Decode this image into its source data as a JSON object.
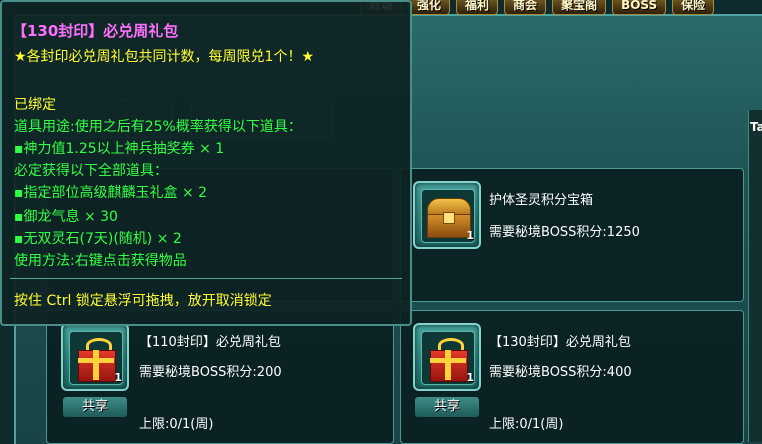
{
  "top_nav": {
    "tabs": [
      "商城",
      "强化",
      "福利",
      "商会",
      "聚宝阁",
      "BOSS",
      "保险"
    ]
  },
  "side_strip": {
    "glyph": "Ta"
  },
  "items": [
    {
      "icon": "treasure-chest",
      "count": "1",
      "name": "护体圣灵积分宝箱",
      "cost": "需要秘境BOSS积分:1250"
    },
    {
      "icon": "gift-box",
      "count": "1",
      "name": "【110封印】必兑周礼包",
      "cost": "需要秘境BOSS积分:200",
      "limit": "上限:0/1(周)",
      "share_label": "共享"
    },
    {
      "icon": "gift-box",
      "count": "1",
      "name": "【130封印】必兑周礼包",
      "cost": "需要秘境BOSS积分:400",
      "limit": "上限:0/1(周)",
      "share_label": "共享"
    }
  ],
  "tooltip": {
    "title": "【130封印】必兑周礼包",
    "notice": "★各封印必兑周礼包共同计数，每周限兑1个！★",
    "bound": "已绑定",
    "usage": "道具用途:使用之后有25%概率获得以下道具：",
    "chance_item": "▪神力值1.25以上神兵抽奖券  × 1",
    "guaranteed": "必定获得以下全部道具：",
    "guaranteed_items": [
      "▪指定部位高级麒麟玉礼盒  × 2",
      "▪御龙气息  × 30",
      "▪无双灵石(7天)(随机)  × 2"
    ],
    "method": "使用方法:右键点击获得物品",
    "lock_hint": "按住 Ctrl 锁定悬浮可拖拽，放开取消锁定"
  },
  "colors": {
    "title": "#ff70ff",
    "yellow_text": "#ffff33",
    "green_text": "#33ff44"
  }
}
